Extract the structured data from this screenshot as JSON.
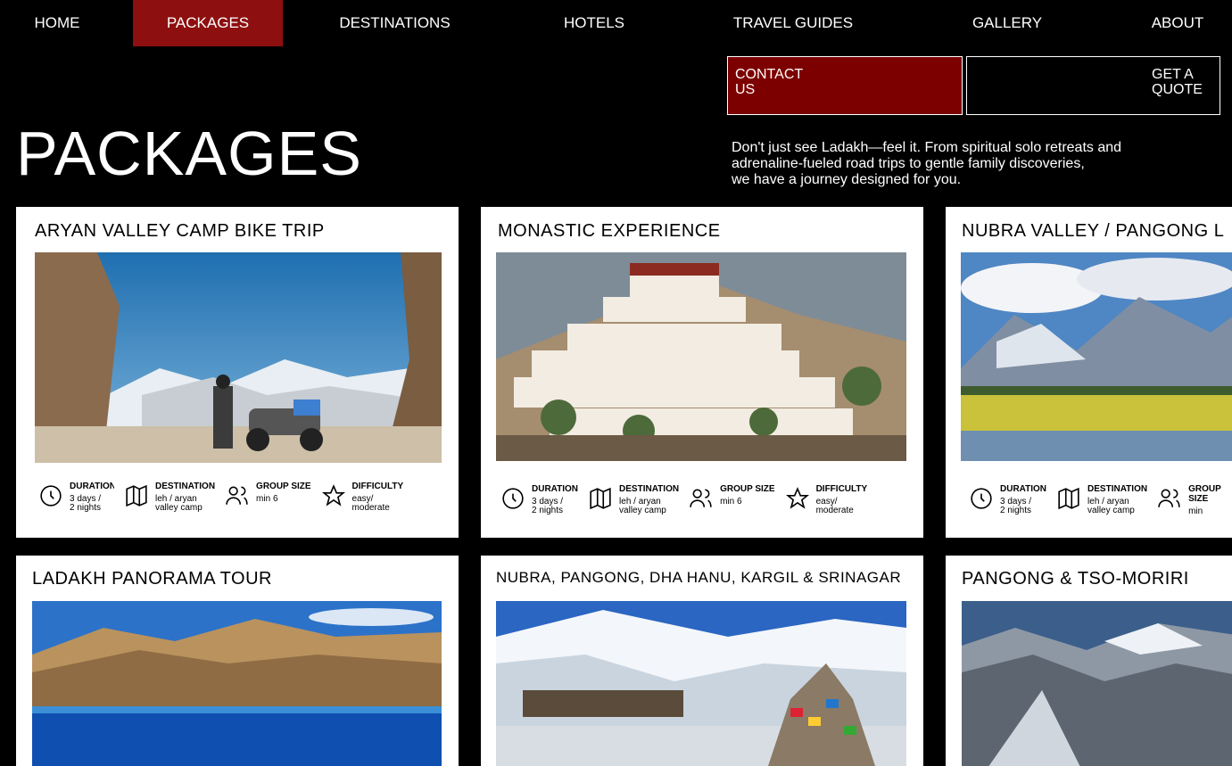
{
  "nav": {
    "items": [
      {
        "label": "HOME"
      },
      {
        "label": "PACKAGES"
      },
      {
        "label": "DESTINATIONS"
      },
      {
        "label": "HOTELS"
      },
      {
        "label": "TRAVEL GUIDES"
      },
      {
        "label": "GALLERY"
      },
      {
        "label": "ABOUT"
      }
    ],
    "active": "PACKAGES",
    "accent_color": "#8e0f0f"
  },
  "buttons": {
    "contact_line1": "CONTACT",
    "contact_line2": "US",
    "quote_line1": "GET A",
    "quote_line2": "QUOTE"
  },
  "page": {
    "title": "PACKAGES",
    "intro_line1": "Don't just see Ladakh—feel it. From spiritual solo retreats and",
    "intro_line2": "adrenaline-fueled road trips to gentle family discoveries,",
    "intro_line3": "we have a journey designed for you."
  },
  "meta_labels": {
    "duration": "DURATION",
    "destination": "DESTINATION",
    "group_size": "GROUP SIZE",
    "difficulty": "DIFFICULTY"
  },
  "packages": [
    {
      "title": "ARYAN VALLEY CAMP BIKE TRIP",
      "duration": "3 days / 2 nights",
      "destination": "leh / aryan valley camp",
      "group_size": "min 6",
      "difficulty": "easy/ moderate"
    },
    {
      "title": "MONASTIC EXPERIENCE",
      "duration": "3 days / 2 nights",
      "destination": "leh / aryan valley camp",
      "group_size": "min 6",
      "difficulty": "easy/ moderate"
    },
    {
      "title": "NUBRA VALLEY / PANGONG L",
      "duration": "3 days / 2 nights",
      "destination": "leh / aryan valley camp",
      "group_size": "min"
    },
    {
      "title": "LADAKH PANORAMA TOUR"
    },
    {
      "title": "NUBRA, PANGONG, DHA HANU, KARGIL & SRINAGAR"
    },
    {
      "title": "PANGONG & TSO-MORIRI"
    }
  ]
}
